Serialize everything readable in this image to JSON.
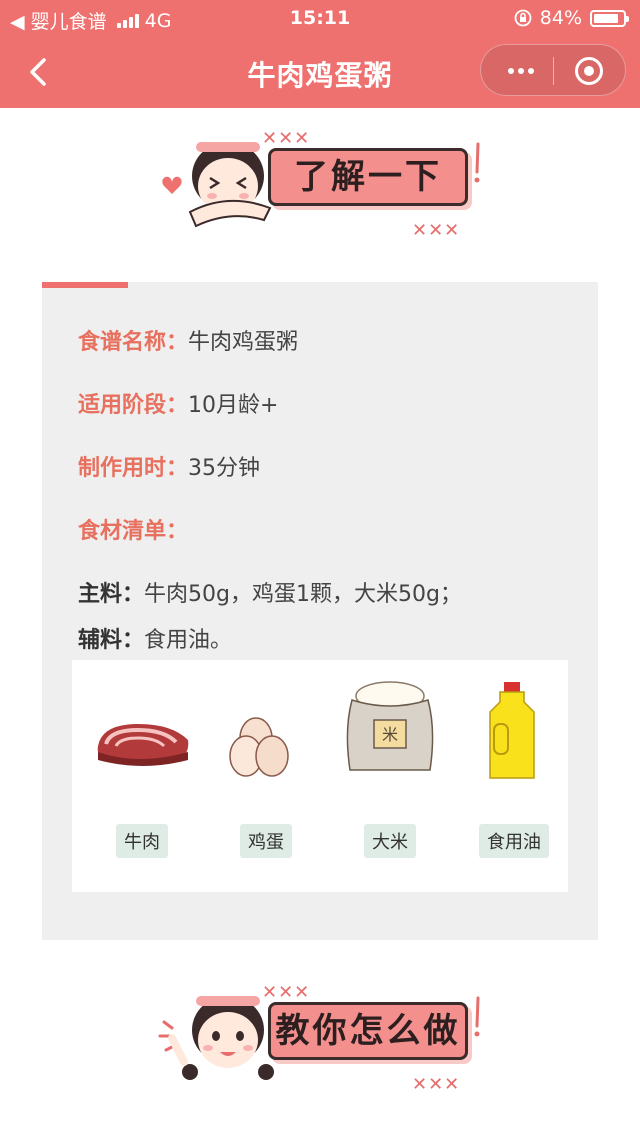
{
  "status": {
    "back_app": "◀ 婴儿食谱",
    "network": "4G",
    "time": "15:11",
    "battery": "84%"
  },
  "nav": {
    "title": "牛肉鸡蛋粥"
  },
  "banner_top": {
    "label": "了解一下",
    "marks": "✕✕✕"
  },
  "info": {
    "name_key": "食谱名称：",
    "name_val": "牛肉鸡蛋粥",
    "stage_key": "适用阶段：",
    "stage_val": "10月龄+",
    "time_key": "制作用时：",
    "time_val": "35分钟",
    "list_key": "食材清单：",
    "main_key": "主料：",
    "main_val": "牛肉50g，鸡蛋1颗，大米50g；",
    "aux_key": "辅料：",
    "aux_val": "食用油。"
  },
  "ingredients": [
    "牛肉",
    "鸡蛋",
    "大米",
    "食用油"
  ],
  "banner_bottom": {
    "label": "教你怎么做",
    "marks": "✕✕✕"
  },
  "colors": {
    "accent": "#ee7170",
    "key_text": "#e8705e",
    "tag_bg": "#dfece6"
  }
}
